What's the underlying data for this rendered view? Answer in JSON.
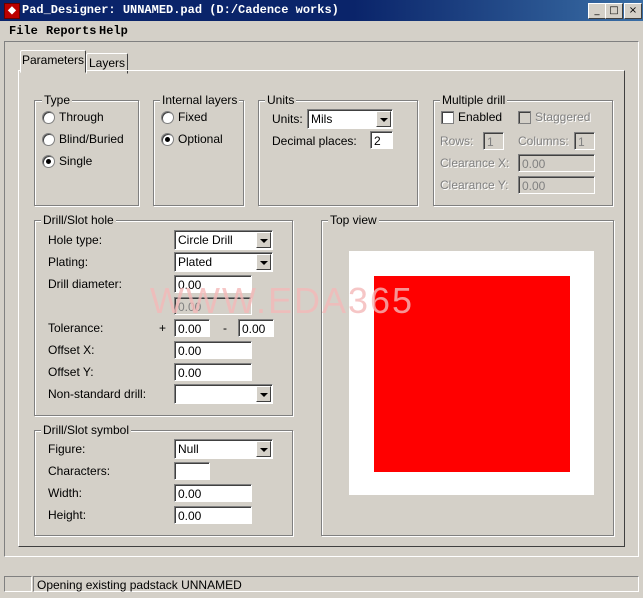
{
  "window": {
    "title": "Pad_Designer: UNNAMED.pad (D:/Cadence works)",
    "icon_name": "pad-designer-icon",
    "controls": {
      "minimize": "_",
      "maximize": "□",
      "close": "×"
    }
  },
  "menu": {
    "items": [
      "File",
      "Reports",
      "Help"
    ]
  },
  "tabs": [
    {
      "label": "Parameters",
      "active": true
    },
    {
      "label": "Layers",
      "active": false
    }
  ],
  "type_group": {
    "legend": "Type",
    "options": [
      {
        "label": "Through",
        "selected": false
      },
      {
        "label": "Blind/Buried",
        "selected": false
      },
      {
        "label": "Single",
        "selected": true
      }
    ]
  },
  "internal_layers": {
    "legend": "Internal layers",
    "options": [
      {
        "label": "Fixed",
        "selected": false
      },
      {
        "label": "Optional",
        "selected": true
      }
    ]
  },
  "units_group": {
    "legend": "Units",
    "units_label": "Units:",
    "units_value": "Mils",
    "decimal_label": "Decimal places:",
    "decimal_value": "2"
  },
  "multiple_drill": {
    "legend": "Multiple drill",
    "enabled_label": "Enabled",
    "enabled": false,
    "staggered_label": "Staggered",
    "staggered": false,
    "rows_label": "Rows:",
    "rows_value": "1",
    "columns_label": "Columns:",
    "columns_value": "1",
    "clearance_x_label": "Clearance X:",
    "clearance_x_value": "0.00",
    "clearance_y_label": "Clearance Y:",
    "clearance_y_value": "0.00"
  },
  "drill_hole": {
    "legend": "Drill/Slot hole",
    "hole_type_label": "Hole type:",
    "hole_type_value": "Circle Drill",
    "plating_label": "Plating:",
    "plating_value": "Plated",
    "drill_diameter_label": "Drill diameter:",
    "drill_diameter_value": "0.00",
    "drill_diameter_value2": "0.00",
    "tolerance_label": "Tolerance:",
    "tolerance_plus_sign": "+",
    "tolerance_plus_value": "0.00",
    "tolerance_minus_sign": "-",
    "tolerance_minus_value": "0.00",
    "offset_x_label": "Offset X:",
    "offset_x_value": "0.00",
    "offset_y_label": "Offset Y:",
    "offset_y_value": "0.00",
    "nonstandard_label": "Non-standard drill:",
    "nonstandard_value": ""
  },
  "drill_symbol": {
    "legend": "Drill/Slot symbol",
    "figure_label": "Figure:",
    "figure_value": "Null",
    "characters_label": "Characters:",
    "characters_value": "",
    "width_label": "Width:",
    "width_value": "0.00",
    "height_label": "Height:",
    "height_value": "0.00"
  },
  "top_view": {
    "legend": "Top view",
    "pad_color": "#ff0000",
    "background_color": "#ffffff"
  },
  "watermark": "WWW.EDA365",
  "status": {
    "left": "",
    "message": "Opening existing padstack UNNAMED"
  }
}
